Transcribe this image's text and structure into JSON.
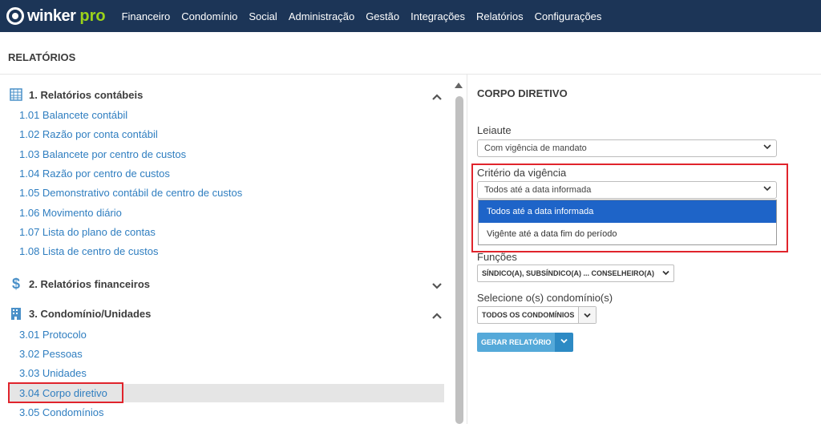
{
  "brand": {
    "word": "winker",
    "pro": "pro"
  },
  "nav": [
    "Financeiro",
    "Condomínio",
    "Social",
    "Administração",
    "Gestão",
    "Integrações",
    "Relatórios",
    "Configurações"
  ],
  "page_title": "RELATÓRIOS",
  "sections": [
    {
      "title": "1. Relatórios contábeis",
      "icon": "spreadsheet-icon",
      "expanded": true,
      "items": [
        "1.01 Balancete contábil",
        "1.02 Razão por conta contábil",
        "1.03 Balancete por centro de custos",
        "1.04 Razão por centro de custos",
        "1.05 Demonstrativo contábil de centro de custos",
        "1.06 Movimento diário",
        "1.07 Lista do plano de contas",
        "1.08 Lista de centro de custos"
      ]
    },
    {
      "title": "2. Relatórios financeiros",
      "icon": "dollar-icon",
      "expanded": false,
      "items": []
    },
    {
      "title": "3. Condomínio/Unidades",
      "icon": "building-icon",
      "expanded": true,
      "items": [
        "3.01 Protocolo",
        "3.02 Pessoas",
        "3.03 Unidades",
        "3.04 Corpo diretivo",
        "3.05 Condomínios"
      ]
    }
  ],
  "selected_item": "3.04 Corpo diretivo",
  "form": {
    "title": "CORPO DIRETIVO",
    "leiaute_label": "Leiaute",
    "leiaute_value": "Com vigência de mandato",
    "criterio_label": "Critério da vigência",
    "criterio_value": "Todos até a data informada",
    "criterio_options": [
      "Todos até a data informada",
      "Vigênte até a data fim do período"
    ],
    "funcoes_label": "Funções",
    "funcoes_value": "SÍNDICO(A), SUBSÍNDICO(A) ... CONSELHEIRO(A)",
    "condominios_label": "Selecione o(s) condomínio(s)",
    "condominios_value": "TODOS OS CONDOMÍNIOS",
    "generate_label": "GERAR RELATÓRIO"
  },
  "colors": {
    "nav_bg": "#1c3557",
    "link": "#2f7ec0",
    "highlight": "#e0242c",
    "active_option": "#1e64c8",
    "button": "#55a9d9"
  }
}
